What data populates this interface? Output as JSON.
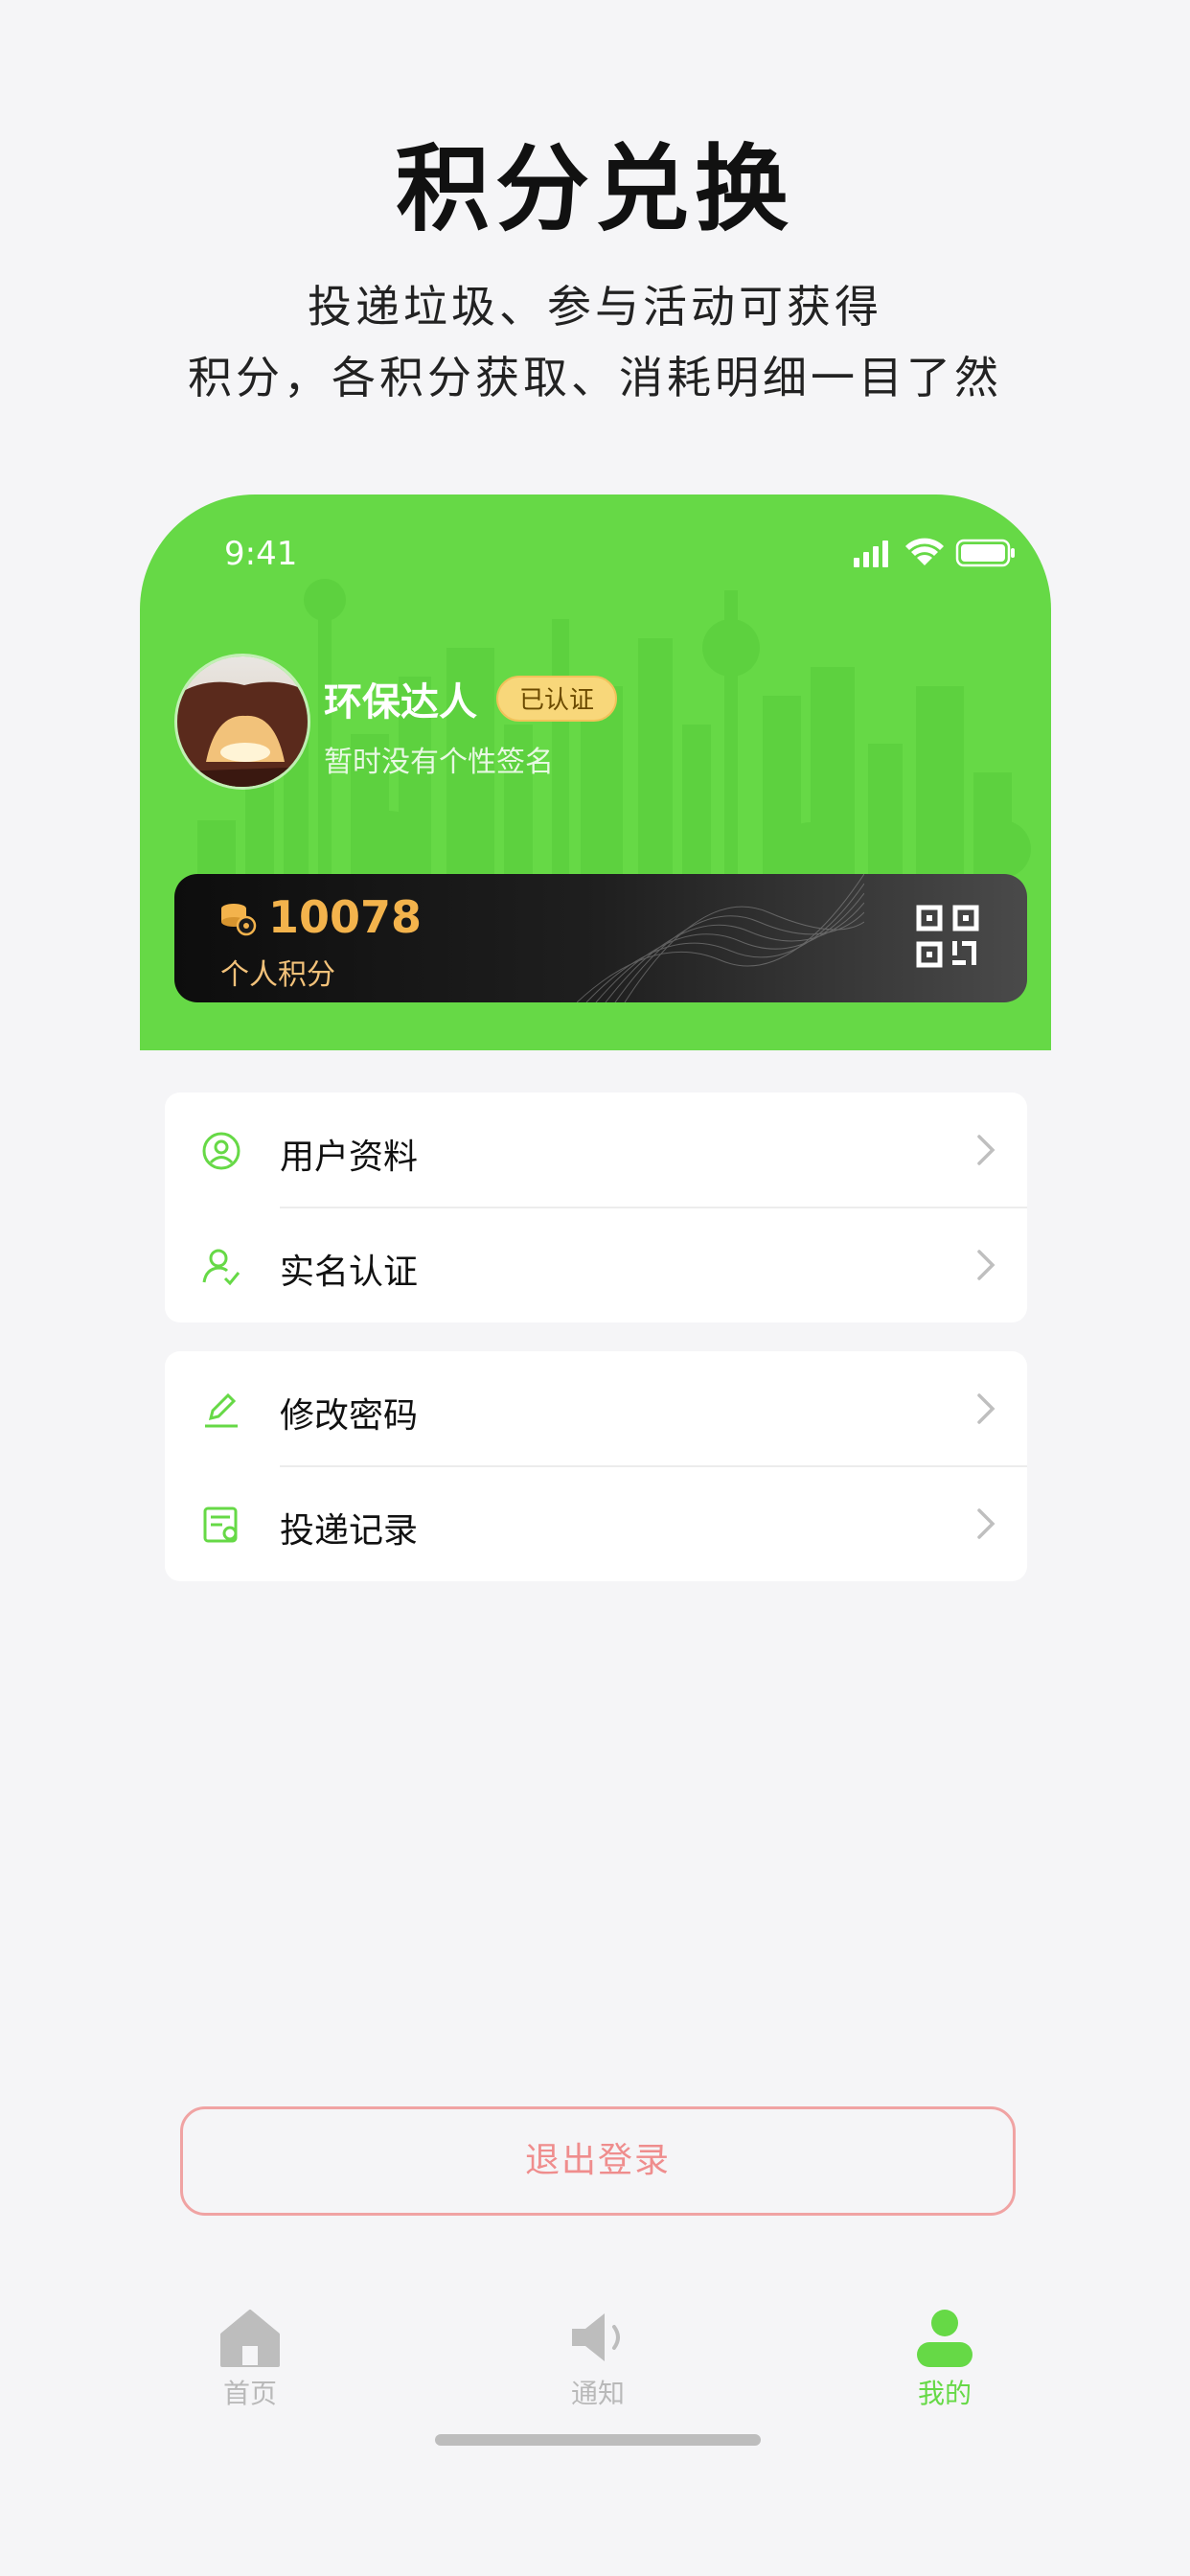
{
  "promo": {
    "title": "积分兑换",
    "subtitle_line1": "投递垃圾、参与活动可获得",
    "subtitle_line2": "积分，各积分获取、消耗明细一目了然"
  },
  "status_bar": {
    "time": "9:41"
  },
  "profile": {
    "name": "环保达人",
    "badge": "已认证",
    "signature": "暂时没有个性签名"
  },
  "points": {
    "value": "10078",
    "label": "个人积分"
  },
  "menu_group_1": [
    {
      "label": "用户资料",
      "icon": "user-circle-icon"
    },
    {
      "label": "实名认证",
      "icon": "verify-user-icon"
    }
  ],
  "menu_group_2": [
    {
      "label": "修改密码",
      "icon": "pencil-icon"
    },
    {
      "label": "投递记录",
      "icon": "record-icon"
    }
  ],
  "logout": {
    "label": "退出登录"
  },
  "tabs": [
    {
      "label": "首页",
      "icon": "home-icon",
      "active": false
    },
    {
      "label": "通知",
      "icon": "speaker-icon",
      "active": false
    },
    {
      "label": "我的",
      "icon": "person-icon",
      "active": true
    }
  ],
  "colors": {
    "brand_green": "#66d946",
    "points_gold": "#f3b34c",
    "logout_red": "#ef8d8d",
    "badge_yellow": "#f8d77a"
  }
}
